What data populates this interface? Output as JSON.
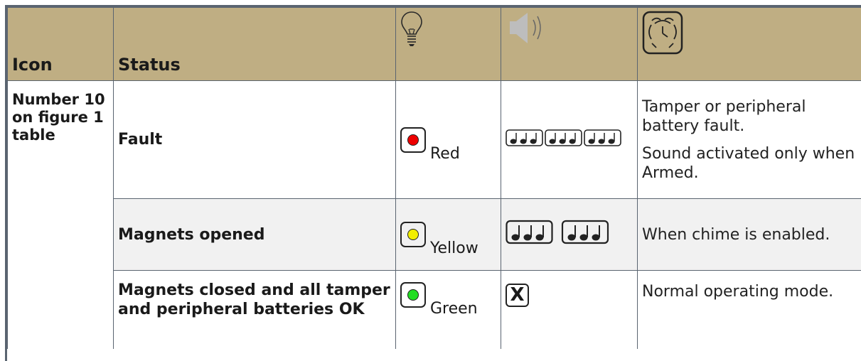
{
  "header": {
    "icon": "Icon",
    "status": "Status",
    "col3_icon": "lightbulb-icon",
    "col4_icon": "speaker-icon",
    "col5_icon": "alarm-clock-icon"
  },
  "icon_cell": "Number 10 on figure 1 table",
  "rows": [
    {
      "status": "Fault",
      "led_label": "Red",
      "led_color": "#ee0000",
      "sound": "three-beeps-triple",
      "desc1": "Tamper or peripheral battery fault.",
      "desc2": "Sound activated only when Armed."
    },
    {
      "status": "Magnets opened",
      "led_label": "Yellow",
      "led_color": "#f2ee00",
      "sound": "three-beeps-double",
      "desc1": "When chime is enabled."
    },
    {
      "status": "Magnets closed and all tamper and peripheral batteries OK",
      "led_label": "Green",
      "led_color": "#22dd22",
      "sound": "no-sound",
      "desc1": "Normal operating mode."
    }
  ],
  "no_sound_symbol": "X"
}
